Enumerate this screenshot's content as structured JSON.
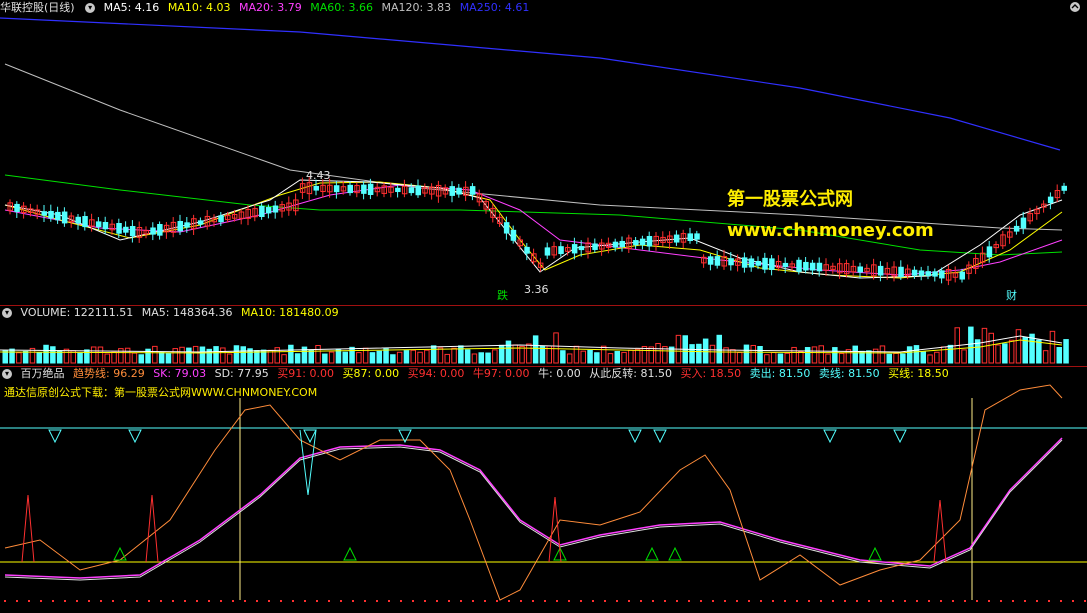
{
  "main": {
    "title": "华联控股(日线)",
    "ma5": "MA5: 4.16",
    "ma10": "MA10: 4.03",
    "ma20": "MA20: 3.79",
    "ma60": "MA60: 3.66",
    "ma120": "MA120: 3.83",
    "ma250": "MA250: 4.61",
    "high_label": "4.43",
    "low_label": "3.36",
    "marker_die": "跌",
    "marker_cai": "财"
  },
  "watermark": {
    "site": "第一股票公式网",
    "url": "www.chnmoney.com"
  },
  "volume": {
    "volume": "VOLUME: 122111.51",
    "ma5": "MA5: 148364.36",
    "ma10": "MA10: 181480.09"
  },
  "indicator": {
    "name": "百万绝品",
    "trend": "趋势线: 96.29",
    "sk": "SK: 79.03",
    "sd": "SD: 77.95",
    "buy91": "买91: 0.00",
    "buy87": "买87: 0.00",
    "buy94": "买94: 0.00",
    "bull97": "牛97: 0.00",
    "bull": "牛: 0.00",
    "reverse": "从此反转: 81.50",
    "buyin": "买入: 18.50",
    "sellout": "卖出: 81.50",
    "sellline": "卖线: 81.50",
    "buyline": "买线: 18.50",
    "download": "通达信原创公式下载：第一股票公式网WWW.CHNMONEY.COM"
  },
  "colors": {
    "up": "#ff3030",
    "down": "#54ffff",
    "ma5": "#ffffff",
    "ma10": "#ffff00",
    "ma20": "#ff40ff",
    "ma60": "#00e000",
    "ma120": "#c0c0c0",
    "ma250": "#3030ff",
    "watermark": "#ffee00"
  }
}
